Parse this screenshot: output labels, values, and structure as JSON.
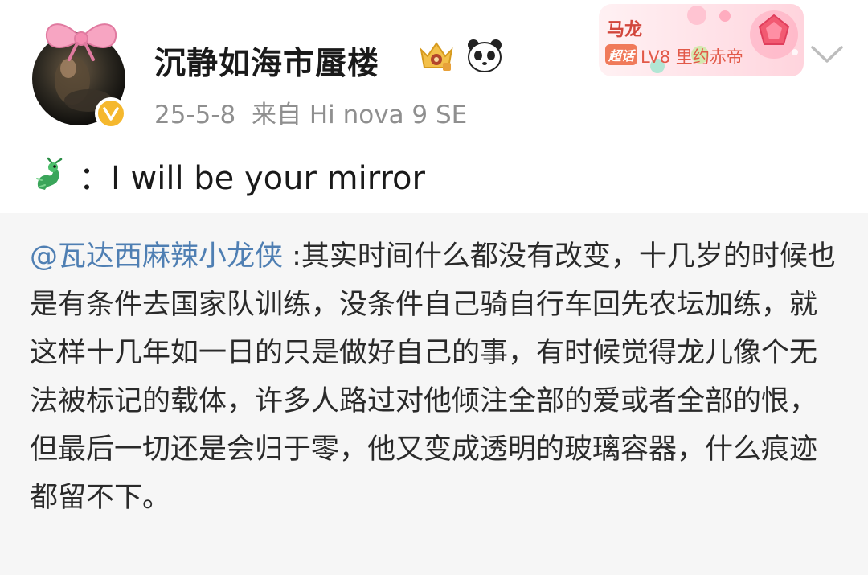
{
  "post": {
    "username": "沉静如海市蜃楼",
    "date": "25-5-8",
    "source": "来自 Hi nova 9 SE",
    "badges": [
      "crown-icon",
      "panda-icon"
    ],
    "verified": true
  },
  "fan_card": {
    "name": "马龙",
    "tag": "超话",
    "level": "LV8 里约赤帝"
  },
  "caption": {
    "emoji": "dragon-icon",
    "text": "：I will be your mirror"
  },
  "repost": {
    "mention": "@瓦达西麻辣小龙侠",
    "text": " :其实时间什么都没有改变，十几岁的时候也是有条件去国家队训练，没条件自己骑自行车回先农坛加练，就这样十几年如一日的只是做好自己的事，有时候觉得龙儿像个无法被标记的载体，许多人路过对他倾注全部的爱或者全部的恨，但最后一切还是会归于零，他又变成透明的玻璃容器，什么痕迹都留不下。"
  },
  "colors": {
    "mention": "#4f7fb3",
    "verified_badge": "#f5b82e",
    "fan_card_text": "#d2463c",
    "repost_bg": "#f6f6f6"
  }
}
